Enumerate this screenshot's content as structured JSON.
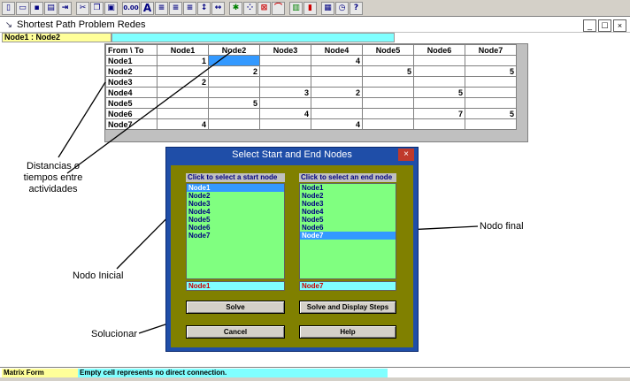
{
  "toolbar": {
    "buttons": [
      "new-icon",
      "open-icon",
      "save-icon",
      "print-icon",
      "exit-icon",
      "cut-icon",
      "copy-icon",
      "paste-icon",
      "decimal-icon",
      "font-icon",
      "align-left-icon",
      "align-center-icon",
      "align-right-icon",
      "row-height-icon",
      "column-width-icon",
      "network-icon",
      "scatter-icon",
      "graph-icon",
      "curve-icon",
      "chart-green-icon",
      "chart-bar-icon",
      "calculator-icon",
      "clock-icon",
      "help-icon"
    ],
    "decimal_label": "0.00",
    "font_label": "A",
    "help_label": "?"
  },
  "window": {
    "title": "Shortest Path Problem Redes",
    "min": "_",
    "max": "☐",
    "close": "×"
  },
  "cellref": "Node1 : Node2",
  "grid": {
    "corner": "From \\ To",
    "columns": [
      "Node1",
      "Node2",
      "Node3",
      "Node4",
      "Node5",
      "Node6",
      "Node7"
    ],
    "rows": [
      {
        "label": "Node1",
        "cells": [
          "1",
          "",
          "",
          "4",
          "",
          "",
          ""
        ]
      },
      {
        "label": "Node2",
        "cells": [
          "",
          "2",
          "",
          "",
          "5",
          "",
          "5"
        ]
      },
      {
        "label": "Node3",
        "cells": [
          "2",
          "",
          "",
          "",
          "",
          "",
          ""
        ]
      },
      {
        "label": "Node4",
        "cells": [
          "",
          "",
          "3",
          "2",
          "",
          "5",
          ""
        ]
      },
      {
        "label": "Node5",
        "cells": [
          "",
          "5",
          "",
          "",
          "",
          "",
          ""
        ]
      },
      {
        "label": "Node6",
        "cells": [
          "",
          "",
          "4",
          "",
          "",
          "7",
          "5"
        ]
      },
      {
        "label": "Node7",
        "cells": [
          "4",
          "",
          "",
          "4",
          "",
          "",
          ""
        ]
      }
    ]
  },
  "annotations": {
    "distancias": "Distancias o\ntiempos entre\nactividades",
    "nodo_inicial": "Nodo Inicial",
    "nodo_final": "Nodo final",
    "solucionar": "Solucionar"
  },
  "dialog": {
    "title": "Select Start and End Nodes",
    "close": "×",
    "start_header": "Click to select a start node",
    "end_header": "Click to select an end node",
    "nodes": [
      "Node1",
      "Node2",
      "Node3",
      "Node4",
      "Node5",
      "Node6",
      "Node7"
    ],
    "start_selected": "Node1",
    "end_selected": "Node7",
    "solve_label": "Solve",
    "solve_steps_label": "Solve and Display Steps",
    "cancel_label": "Cancel",
    "help_label": "Help"
  },
  "status": {
    "mode": "Matrix Form",
    "message": "Empty cell represents no direct connection."
  }
}
